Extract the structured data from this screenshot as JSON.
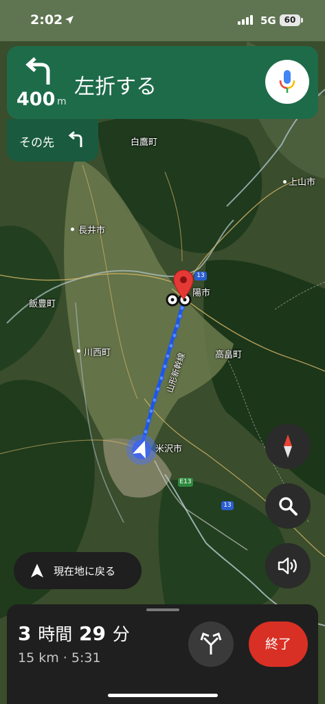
{
  "status_bar": {
    "time": "2:02",
    "network": "5G",
    "battery": "60"
  },
  "navigation": {
    "distance_value": "400",
    "distance_unit": "m",
    "instruction": "左折する",
    "then_label": "その先"
  },
  "map": {
    "place_labels": [
      {
        "name": "白鷹町"
      },
      {
        "name": "上山市"
      },
      {
        "name": "長井市"
      },
      {
        "name": "飯豊町"
      },
      {
        "name": "川西町"
      },
      {
        "name": "高畠町"
      },
      {
        "name": "米沢市"
      },
      {
        "name": "陽市"
      }
    ],
    "railway_label": "山形新幹線",
    "road_shields": [
      "13",
      "13",
      "E13"
    ]
  },
  "controls": {
    "recenter_label": "現在地に戻る"
  },
  "trip": {
    "hours": "3",
    "hours_unit": "時間",
    "minutes": "29",
    "minutes_unit": "分",
    "distance": "15 km",
    "separator": "·",
    "arrival": "5:31",
    "end_label": "終了"
  },
  "colors": {
    "banner": "#1e6b4a",
    "banner_then": "#1a5a3e",
    "route": "#1a56f0",
    "end_button": "#d93025",
    "destination_pin": "#e53935"
  }
}
